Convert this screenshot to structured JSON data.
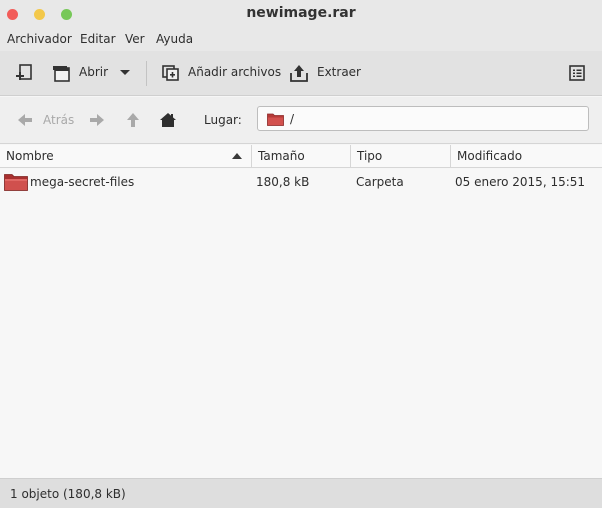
{
  "window": {
    "title": "newimage.rar"
  },
  "menu": {
    "items": [
      "Archivador",
      "Editar",
      "Ver",
      "Ayuda"
    ]
  },
  "toolbar": {
    "open_label": "Abrir",
    "add_label": "Añadir archivos",
    "extract_label": "Extraer"
  },
  "navigation": {
    "back_label": "Atrás",
    "location_label": "Lugar:",
    "location_value": "/"
  },
  "columns": [
    "Nombre",
    "Tamaño",
    "Tipo",
    "Modificado"
  ],
  "sort": {
    "column": "Nombre",
    "direction": "ascending"
  },
  "files": [
    {
      "name": "mega-secret-files",
      "size": "180,8 kB",
      "type": "Carpeta",
      "modified": "05 enero 2015, 15:51",
      "icon": "folder-icon"
    }
  ],
  "status": {
    "text": "1 objeto (180,8 kB)"
  },
  "colors": {
    "close": "#f25c59",
    "minimize": "#f3c84a",
    "maximize": "#77c858",
    "folder": "#c9403d"
  }
}
